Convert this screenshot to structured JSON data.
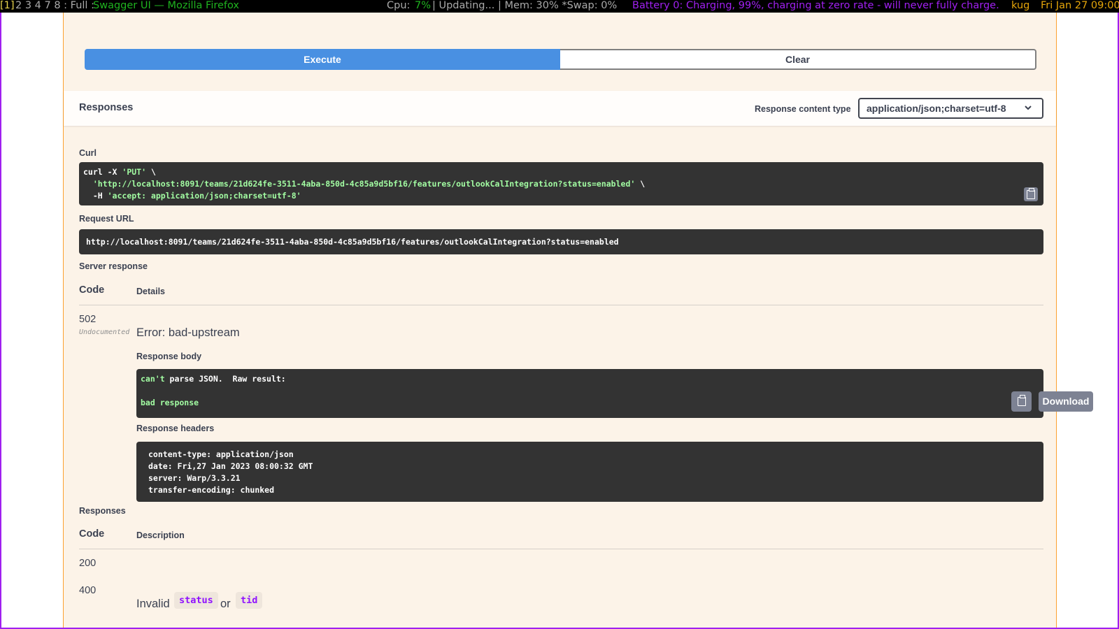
{
  "topbar": {
    "workspaces_current": "[1]",
    "workspaces_rest": "2 3 4 7 8 : Full :",
    "window_title": "Swagger UI — Mozilla Firefox",
    "cpu_label": "Cpu:",
    "cpu_value": "7%",
    "status": "| Updating... | Mem: 30% *Swap: 0%",
    "battery": "Battery 0: Charging, 99%, charging at zero rate - will never fully charge.",
    "user": "kug",
    "datetime": "Fri Jan 27 09:00"
  },
  "execute": {
    "execute_label": "Execute",
    "clear_label": "Clear"
  },
  "responses_header": {
    "title": "Responses",
    "content_type_label": "Response content type",
    "content_type_value": "application/json;charset=utf-8"
  },
  "curl": {
    "label": "Curl",
    "line1_cmd": "curl -X ",
    "line1_method": "'PUT'",
    "line1_tail": " \\",
    "line2_url": "'http://localhost:8091/teams/21d624fe-3511-4aba-850d-4c85a9d5bf16/features/outlookCalIntegration?status=enabled'",
    "line2_tail": " \\",
    "line3_flag": "  -H ",
    "line3_header": "'accept: application/json;charset=utf-8'"
  },
  "request_url": {
    "label": "Request URL",
    "value": "http://localhost:8091/teams/21d624fe-3511-4aba-850d-4c85a9d5bf16/features/outlookCalIntegration?status=enabled"
  },
  "server_response": {
    "label": "Server response",
    "col_code": "Code",
    "col_details": "Details",
    "code": "502",
    "undocumented": "Undocumented",
    "error": "Error: bad-upstream",
    "body_label": "Response body",
    "body_line1_word": "can't",
    "body_line1_rest": " parse JSON.  Raw result:",
    "body_line2": "bad response",
    "download_label": "Download",
    "headers_label": "Response headers",
    "headers": [
      "content-type: application/json",
      "date: Fri,27 Jan 2023 08:00:32 GMT",
      "server: Warp/3.3.21",
      "transfer-encoding: chunked"
    ]
  },
  "responses": {
    "label": "Responses",
    "col_code": "Code",
    "col_description": "Description",
    "rows": [
      {
        "code": "200"
      },
      {
        "code": "400",
        "text_before": "Invalid",
        "param1": "status",
        "text_mid": "or",
        "param2": "tid"
      }
    ]
  },
  "colors": {
    "execute_blue": "#4990e2",
    "put_orange": "#fca130",
    "code_bg": "#333333",
    "string_green": "#a2fca2",
    "param_purple": "#9012fe",
    "frame_purple": "#a020f0"
  },
  "icons": [
    "copy-icon",
    "chevron-down-icon"
  ]
}
